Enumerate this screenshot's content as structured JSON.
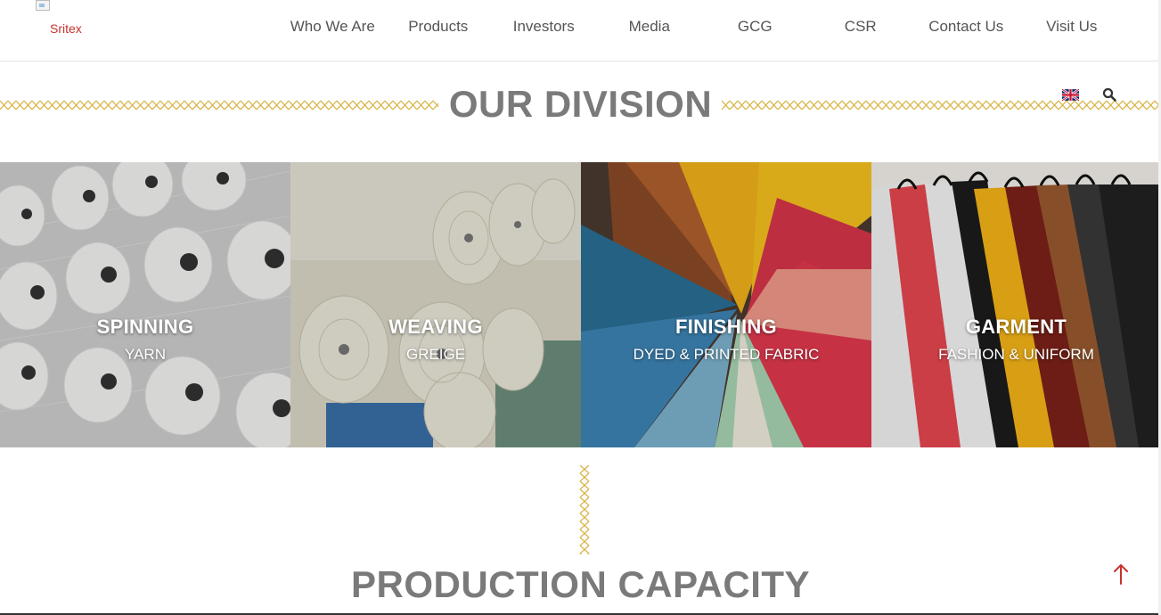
{
  "header": {
    "logo_alt": "Sritex",
    "nav": [
      "Who We Are",
      "Products",
      "Investors",
      "Media",
      "GCG",
      "CSR",
      "Contact Us",
      "Visit Us"
    ]
  },
  "utility": {
    "language_flag": "uk-flag-icon",
    "search_icon": "search-icon"
  },
  "division": {
    "title": "OUR DIVISION",
    "tiles": [
      {
        "title": "SPINNING",
        "subtitle": "YARN"
      },
      {
        "title": "WEAVING",
        "subtitle": "GREIGE"
      },
      {
        "title": "FINISHING",
        "subtitle": "DYED & PRINTED FABRIC"
      },
      {
        "title": "GARMENT",
        "subtitle": "FASHION & UNIFORM"
      }
    ]
  },
  "production": {
    "title": "PRODUCTION CAPACITY"
  },
  "colors": {
    "brand_red": "#c8322d",
    "stitch_gold": "#d8b64a",
    "title_gray": "#7a7a7a"
  },
  "back_to_top_icon": "arrow-up-icon"
}
